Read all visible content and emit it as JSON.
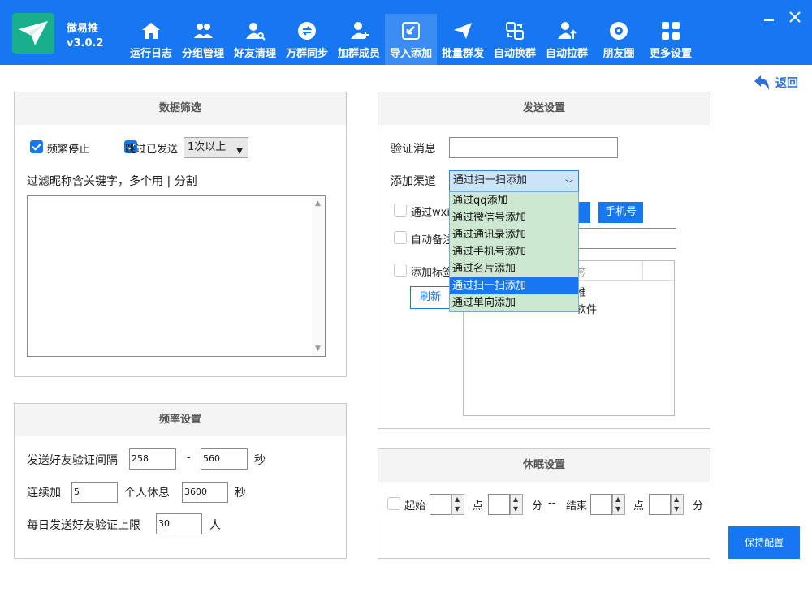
{
  "app": {
    "name": "微易推",
    "version": "v3.0.2"
  },
  "nav": [
    {
      "id": "log",
      "label": "运行日志",
      "icon": "home-icon"
    },
    {
      "id": "group",
      "label": "分组管理",
      "icon": "users-icon"
    },
    {
      "id": "clean",
      "label": "好友清理",
      "icon": "user-search-icon"
    },
    {
      "id": "sync",
      "label": "万群同步",
      "icon": "sync-icon"
    },
    {
      "id": "join",
      "label": "加群成员",
      "icon": "user-add-icon"
    },
    {
      "id": "import",
      "label": "导入添加",
      "icon": "import-icon"
    },
    {
      "id": "mass",
      "label": "批量群发",
      "icon": "send-icon"
    },
    {
      "id": "swap",
      "label": "自动换群",
      "icon": "swap-icon"
    },
    {
      "id": "pull",
      "label": "自动拉群",
      "icon": "user-up-icon"
    },
    {
      "id": "moments",
      "label": "朋友圈",
      "icon": "camera-icon"
    },
    {
      "id": "more",
      "label": "更多设置",
      "icon": "grid-icon"
    }
  ],
  "active_nav": "导入添加",
  "back_label": "返回",
  "filter": {
    "title": "数据筛选",
    "freq_stop": "频繁停止",
    "skip_sent": "跳过已发送",
    "skip_select": "1次以上",
    "keyword_label": "过滤昵称含关键字，多个用 | 分割",
    "keyword_value": ""
  },
  "rate": {
    "title": "频率设置",
    "interval_label": "发送好友验证间隔",
    "interval_min": "258",
    "interval_dash": "-",
    "interval_max": "560",
    "sec": "秒",
    "continuous_label": "连续加",
    "continuous_value": "5",
    "rest_label": "个人休息",
    "rest_value": "3600",
    "daily_label": "每日发送好友验证上限",
    "daily_value": "30",
    "person": "人"
  },
  "send": {
    "title": "发送设置",
    "verify_label": "验证消息",
    "verify_value": "",
    "channel_label": "添加渠道",
    "channel_value": "通过扫一扫添加",
    "channel_options": [
      "通过qq添加",
      "通过微信号添加",
      "通过通讯录添加",
      "通过手机号添加",
      "通过名片添加",
      "通过扫一扫添加",
      "通过单向添加"
    ],
    "via_wxid": "通过wxi",
    "phone_btn": "手机号",
    "auto_remark": "自动备注",
    "add_tag": "添加标签",
    "refresh": "刷新",
    "tag_header": "签",
    "tag_rows": [
      "推",
      "软件"
    ]
  },
  "sleep": {
    "title": "休眠设置",
    "start": "起始",
    "hour": "点",
    "minute": "分",
    "sep": "--",
    "end": "结束"
  },
  "save_btn": "保持配置"
}
